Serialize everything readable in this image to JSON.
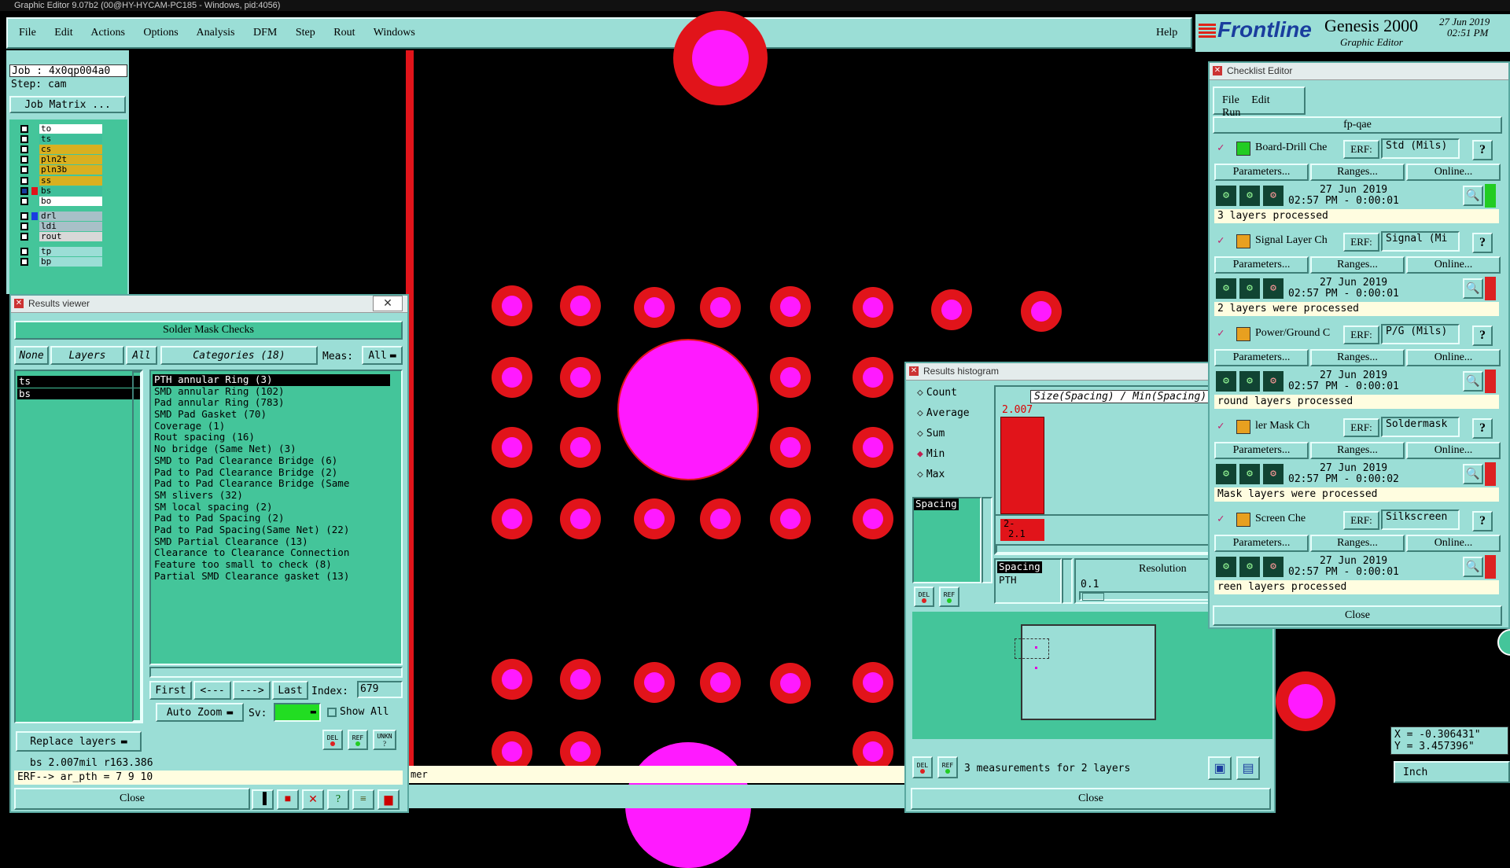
{
  "app": {
    "window_title": "Graphic Editor 9.07b2 (00@HY-HYCAM-PC185 - Windows, pid:4056)",
    "menu": [
      "File",
      "Edit",
      "Actions",
      "Options",
      "Analysis",
      "DFM",
      "Step",
      "Rout",
      "Windows"
    ],
    "help": "Help",
    "brand": "Frontline",
    "product": "Genesis 2000",
    "subtitle": "Graphic Editor",
    "date": "27 Jun 2019",
    "time": "02:51 PM"
  },
  "job": {
    "job": "Job : 4x0qp004a0",
    "step": "Step: cam",
    "matrix_button": "Job Matrix ..."
  },
  "layers": [
    {
      "name": "to",
      "color": "#ffffff"
    },
    {
      "name": "ts",
      "color": "#3fbf9a"
    },
    {
      "name": "cs",
      "color": "#d9b020"
    },
    {
      "name": "pln2t",
      "color": "#d9b020"
    },
    {
      "name": "pln3b",
      "color": "#d9b020"
    },
    {
      "name": "ss",
      "color": "#d9b020"
    },
    {
      "name": "bs",
      "color": "#3fbf9a"
    },
    {
      "name": "bo",
      "color": "#ffffff"
    },
    {
      "name": "drl",
      "color": "#a8c0c8"
    },
    {
      "name": "ldi",
      "color": "#a8c0c8"
    },
    {
      "name": "rout",
      "color": "#d8d8d8"
    },
    {
      "name": "tp",
      "color": "#9bded6"
    },
    {
      "name": "bp",
      "color": "#9bded6"
    }
  ],
  "results_viewer": {
    "title": "Results viewer",
    "heading": "Solder Mask Checks",
    "none": "None",
    "layers_btn": "Layers",
    "all": "All",
    "categories": "Categories (18)",
    "meas_label": "Meas:",
    "meas_value": "All",
    "layer_list": [
      "ts",
      "bs"
    ],
    "category_list": [
      "PTH annular Ring (3)",
      "SMD annular Ring (102)",
      "Pad annular Ring (783)",
      "SMD Pad Gasket (70)",
      "Coverage (1)",
      "Rout spacing (16)",
      "No bridge (Same Net) (3)",
      "SMD to Pad Clearance Bridge (6)",
      "Pad to Pad Clearance Bridge (2)",
      "Pad to Pad Clearance Bridge (Same",
      "SM slivers (32)",
      "SM local spacing (2)",
      "Pad to Pad Spacing (2)",
      "Pad to Pad Spacing(Same Net) (22)",
      "SMD Partial Clearance (13)",
      "Clearance to Clearance Connection",
      "Feature too small to check (8)",
      "Partial SMD Clearance gasket (13)"
    ],
    "first": "First",
    "prev": "<---",
    "next": "--->",
    "last": "Last",
    "index_label": "Index:",
    "index_value": "679",
    "auto_zoom": "Auto Zoom",
    "sv_label": "Sv:",
    "show_all": "Show All",
    "replace_layers": "Replace layers",
    "status": "bs 2.007mil  r163.386",
    "erf": "ERF--> ar_pth = 7 9 10",
    "close": "Close",
    "del": "DEL",
    "ref": "REF",
    "unk": "UNKN"
  },
  "histogram": {
    "title": "Results histogram",
    "options": [
      "Count",
      "Average",
      "Sum",
      "Min",
      "Max"
    ],
    "selected": "Min",
    "chart_title": "Size(Spacing) / Min(Spacing)",
    "bar_value": "2.007",
    "bar_range_1": "2-",
    "bar_range_2": "2.1",
    "list_left": [
      "Spacing"
    ],
    "list_right": [
      "Spacing",
      "PTH"
    ],
    "resolution_label": "Resolution",
    "resolution_value": "0.1",
    "status": "3 measurements for 2 layers",
    "close": "Close",
    "del": "DEL",
    "ref": "REF"
  },
  "checklist": {
    "title": "Checklist Editor",
    "menu": [
      "File",
      "Edit",
      "Run"
    ],
    "name": "fp-qae",
    "params": "Parameters...",
    "ranges": "Ranges...",
    "online": "Online...",
    "erf": "ERF:",
    "items": [
      {
        "name": "Board-Drill Che",
        "erf": "Std (Mils)",
        "date": "27 Jun 2019",
        "time": "02:57 PM - 0:00:01",
        "status": "3 layers processed",
        "indicator": "#22cc22"
      },
      {
        "name": "Signal Layer Ch",
        "erf": "Signal (Mi",
        "date": "27 Jun 2019",
        "time": "02:57 PM - 0:00:01",
        "status": "2 layers were processed",
        "indicator": "#dd2222"
      },
      {
        "name": "Power/Ground C",
        "erf": "P/G (Mils)",
        "date": "27 Jun 2019",
        "time": "02:57 PM - 0:00:01",
        "status": "round layers processed",
        "indicator": "#dd2222"
      },
      {
        "name": "ler Mask Ch",
        "erf": "Soldermask",
        "date": "27 Jun 2019",
        "time": "02:57 PM - 0:00:02",
        "status": "Mask layers were processed",
        "indicator": "#dd2222"
      },
      {
        "name": "Screen Che",
        "erf": "Silkscreen",
        "date": "27 Jun 2019",
        "time": "02:57 PM - 0:00:01",
        "status": "reen layers processed",
        "indicator": "#dd2222"
      }
    ],
    "close": "Close"
  },
  "coords": {
    "x": "X = -0.306431\"",
    "y": "Y = 3.457396\"",
    "unit": "Inch"
  },
  "canvas_note": "mer"
}
